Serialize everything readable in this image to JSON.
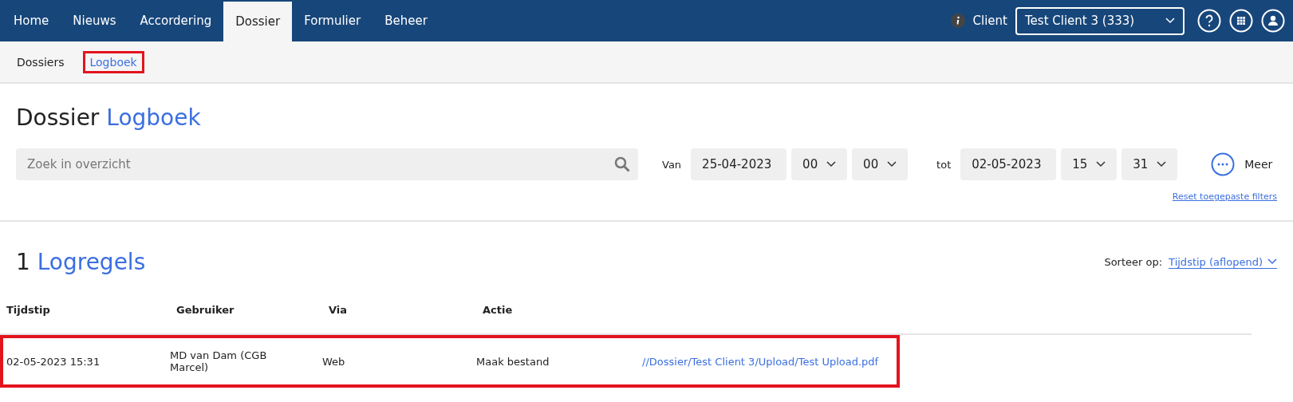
{
  "nav": {
    "tabs": [
      {
        "label": "Home",
        "selected": false
      },
      {
        "label": "Nieuws",
        "selected": false
      },
      {
        "label": "Accordering",
        "selected": false
      },
      {
        "label": "Dossier",
        "selected": true
      },
      {
        "label": "Formulier",
        "selected": false
      },
      {
        "label": "Beheer",
        "selected": false
      }
    ],
    "client_label": "Client",
    "client_select": "Test Client 3 (333)"
  },
  "subnav": [
    {
      "label": "Dossiers",
      "selected": false,
      "highlighted": false
    },
    {
      "label": "Logboek",
      "selected": true,
      "highlighted": true
    }
  ],
  "page_title": {
    "first": "Dossier",
    "second": "Logboek"
  },
  "filters": {
    "search_placeholder": "Zoek in overzicht",
    "van_label": "Van",
    "van_date": "25-04-2023",
    "van_hour": "00",
    "van_minute": "00",
    "tot_label": "tot",
    "tot_date": "02-05-2023",
    "tot_hour": "15",
    "tot_minute": "31",
    "more_label": "Meer",
    "reset_link": "Reset toegepaste filters"
  },
  "results": {
    "count": "1",
    "title": "Logregels",
    "sort_label": "Sorteer op:",
    "sort_value": "Tijdstip (aflopend)"
  },
  "table": {
    "columns": [
      "Tijdstip",
      "Gebruiker",
      "Via",
      "Actie"
    ],
    "rows": [
      {
        "cells": [
          "02-05-2023 15:31",
          "MD van Dam (CGB Marcel)",
          "Web",
          "Maak bestand"
        ],
        "link": "//Dossier/Test Client 3/Upload/Test Upload.pdf",
        "highlighted": true
      }
    ]
  }
}
